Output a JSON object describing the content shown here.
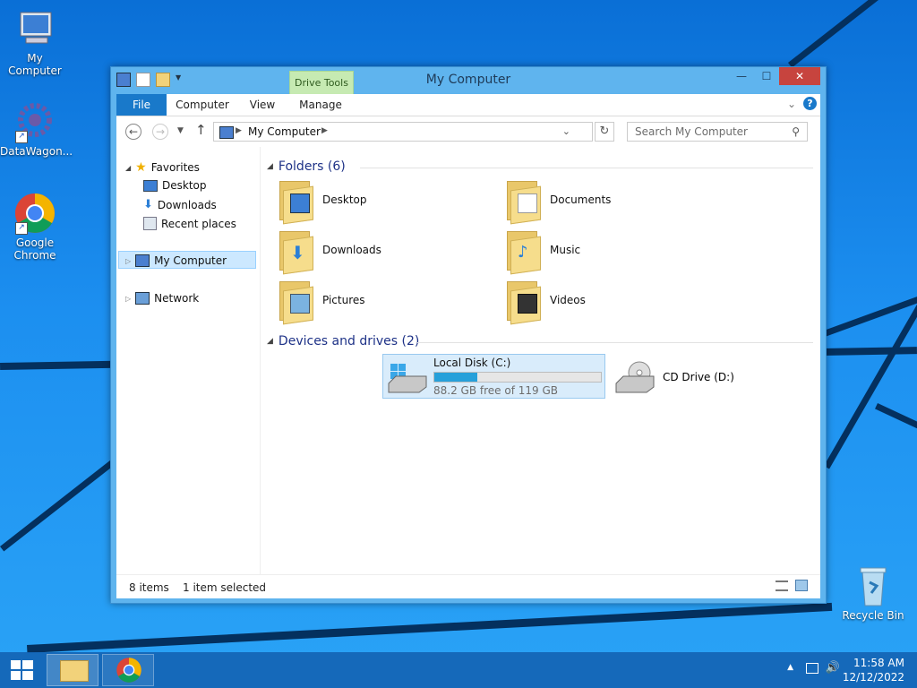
{
  "desktop": {
    "icons": [
      {
        "label": "My Computer"
      },
      {
        "label": "DataWagon..."
      },
      {
        "label": "Google Chrome"
      },
      {
        "label": "Recycle Bin"
      }
    ]
  },
  "window": {
    "title": "My Computer",
    "context_tab": "Drive Tools",
    "tabs": {
      "file": "File",
      "computer": "Computer",
      "view": "View",
      "manage": "Manage"
    },
    "address": "My Computer",
    "search_placeholder": "Search My Computer",
    "nav": {
      "favorites": "Favorites",
      "desktop": "Desktop",
      "downloads": "Downloads",
      "recent": "Recent places",
      "my_computer": "My Computer",
      "network": "Network"
    },
    "folders_header": "Folders (6)",
    "folders": [
      {
        "name": "Desktop"
      },
      {
        "name": "Documents"
      },
      {
        "name": "Downloads"
      },
      {
        "name": "Music"
      },
      {
        "name": "Pictures"
      },
      {
        "name": "Videos"
      }
    ],
    "devices_header": "Devices and drives (2)",
    "drives": {
      "c_name": "Local Disk (C:)",
      "c_free": "88.2 GB free of 119 GB",
      "c_used_fraction": 0.26,
      "d_name": "CD Drive (D:)"
    },
    "status": {
      "items": "8 items",
      "selected": "1 item selected"
    }
  },
  "taskbar": {
    "time": "11:58 AM",
    "date": "12/12/2022"
  },
  "colors": {
    "accent": "#1979ca",
    "selection": "#cce8ff",
    "close": "#c7443e"
  }
}
